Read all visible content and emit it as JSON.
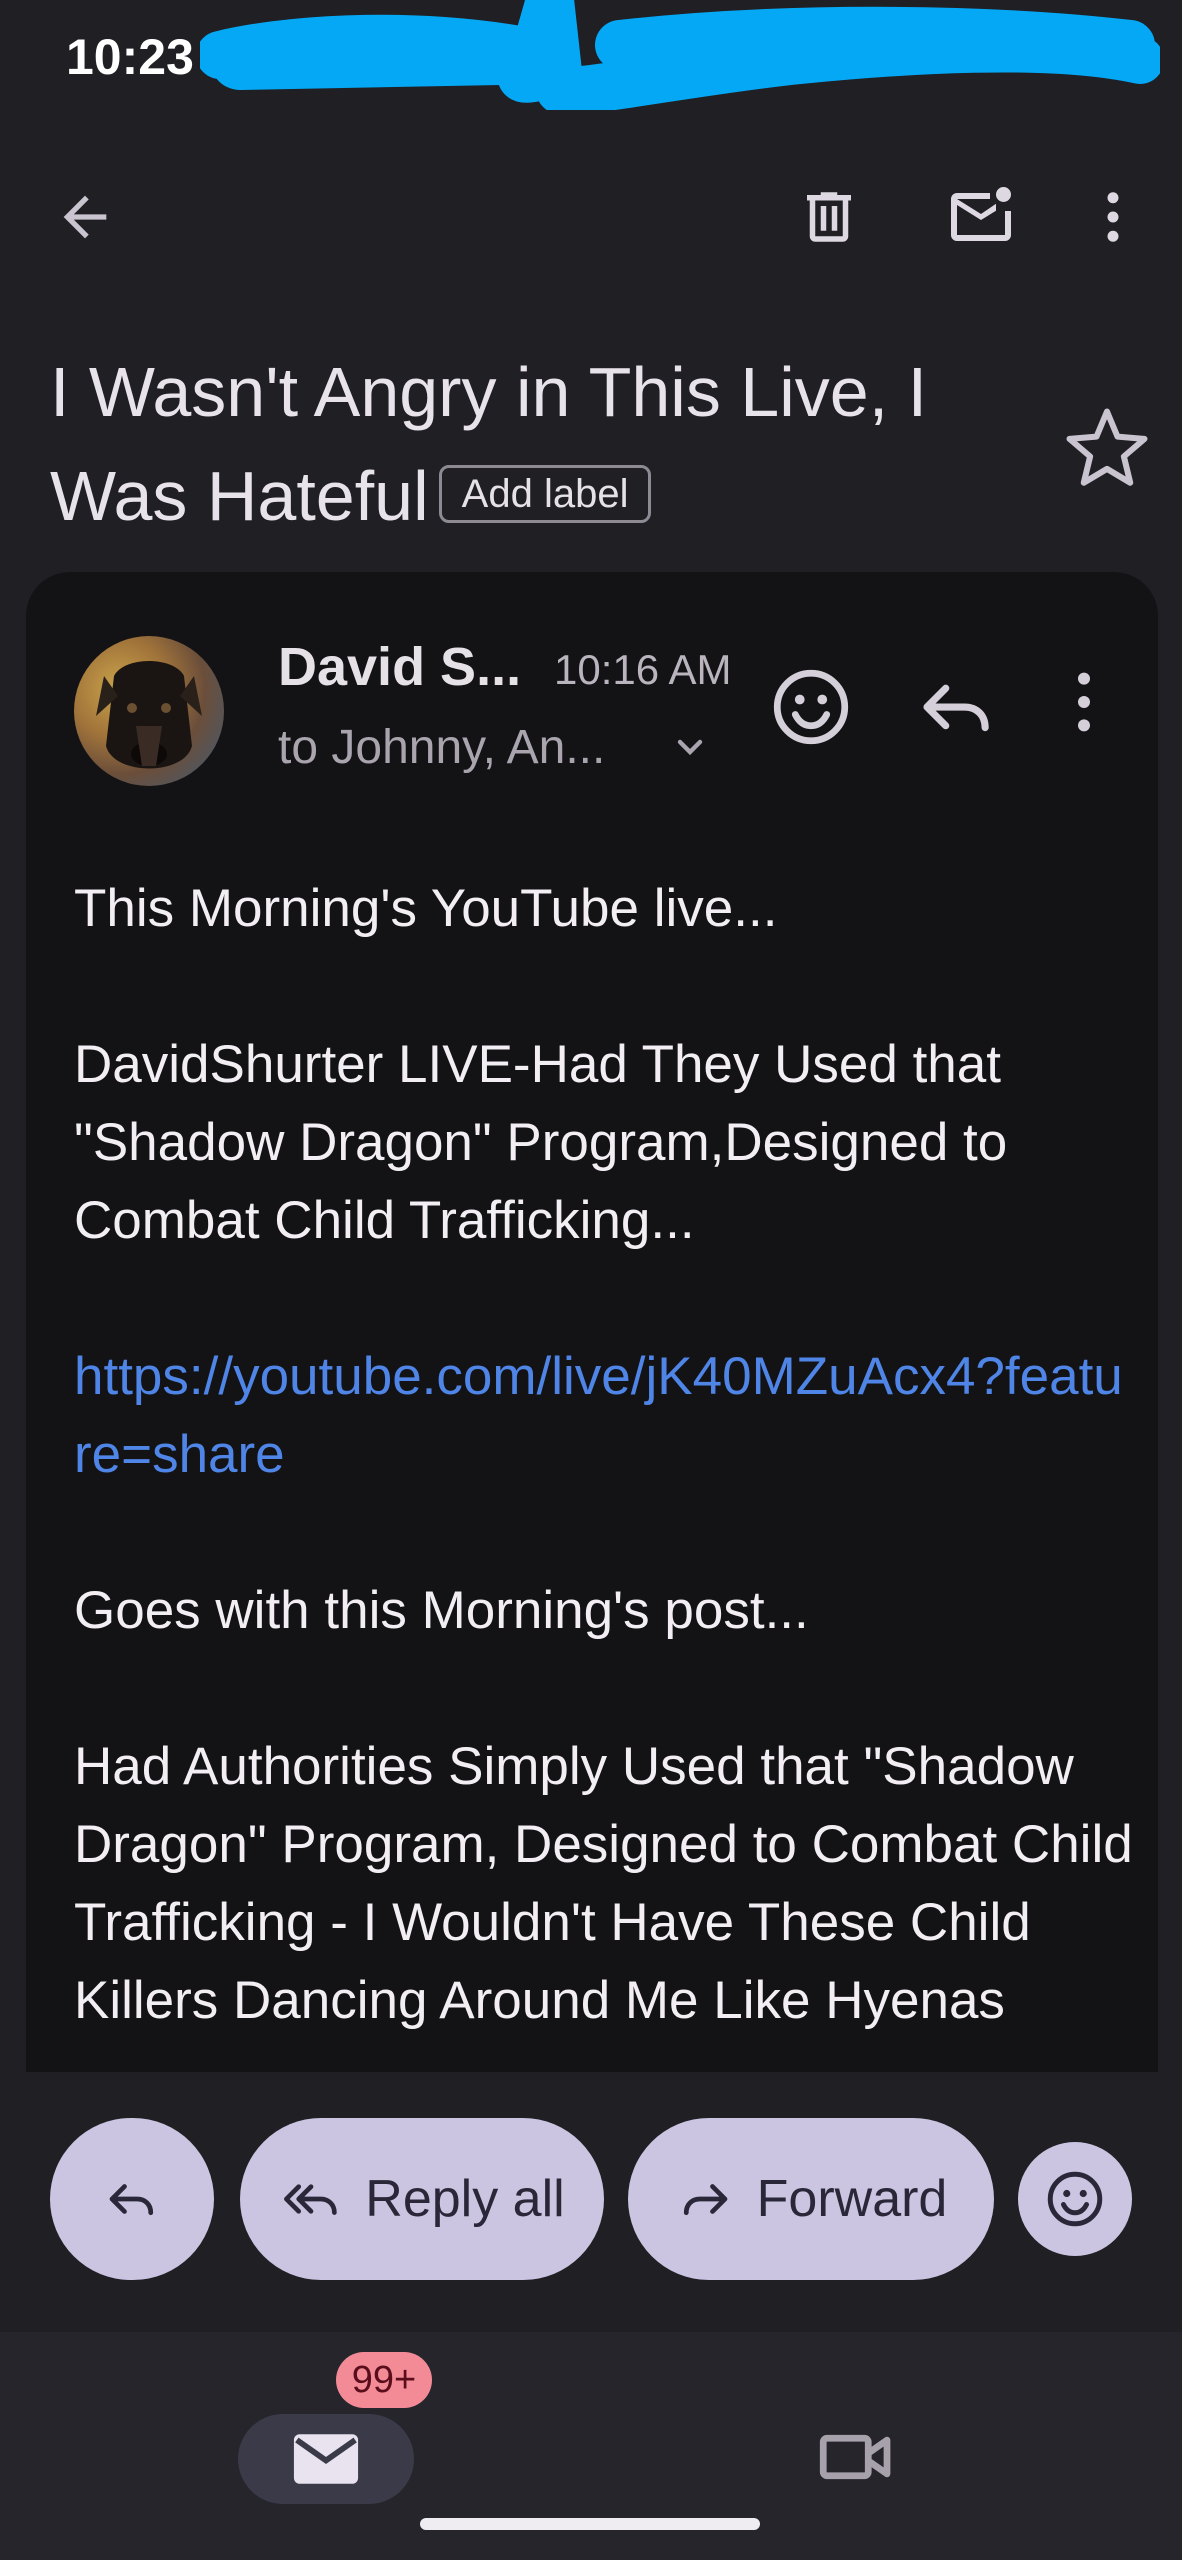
{
  "status_bar": {
    "time": "10:23"
  },
  "toolbar": {
    "back_icon": "arrow-back-icon",
    "delete_icon": "trash-icon",
    "unread_icon": "mark-unread-icon",
    "more_icon": "more-vert-icon"
  },
  "subject": {
    "text": "I Wasn't Angry in This Live, I Was Hateful",
    "add_label": "Add label"
  },
  "message": {
    "sender": "David S...",
    "time": "10:16 AM",
    "recipients": "to Johnny, An...",
    "body": {
      "p1": "This Morning's YouTube live...",
      "p2": "DavidShurter LIVE-Had They Used that \"Shadow Dragon\" Program,Designed to Combat Child Trafficking...",
      "link": "https://youtube.com/live/jK40MZuAcx4?feature=share",
      "p3": "Goes with this Morning's post...",
      "p4": "Had Authorities Simply Used that \"Shadow Dragon\" Program, Designed to Combat Child Trafficking - I Wouldn't Have These Child Killers Dancing Around Me Like Hyenas"
    }
  },
  "actions": {
    "reply_all": "Reply all",
    "forward": "Forward"
  },
  "nav": {
    "mail_badge": "99+"
  },
  "colors": {
    "background": "#1f1f24",
    "card": "#131316",
    "link": "#4f85e6",
    "pill": "#cbc5e2",
    "badge": "#f28b96"
  }
}
